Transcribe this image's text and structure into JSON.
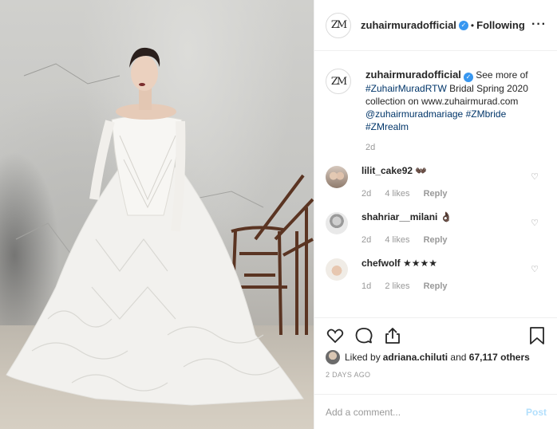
{
  "header": {
    "avatar_text": "ZM",
    "username": "zuhairmuradofficial",
    "separator": "•",
    "follow_status": "Following",
    "more_glyph": "···"
  },
  "caption": {
    "username": "zuhairmuradofficial",
    "text_1": " See more of ",
    "hashtag_1": "#ZuhairMuradRTW",
    "text_2": " Bridal Spring 2020 collection on www.zuhairmurad.com ",
    "mention": "@zuhairmuradmariage",
    "text_3": " ",
    "hashtag_2": "#ZMbride",
    "hashtag_3": "#ZMrealm",
    "time": "2d"
  },
  "comments": [
    {
      "username": "lilit_cake92",
      "text": " 👐🏿",
      "time": "2d",
      "likes": "4 likes",
      "reply": "Reply"
    },
    {
      "username": "shahriar__milani",
      "text": " 👌🏿",
      "time": "2d",
      "likes": "4 likes",
      "reply": "Reply"
    },
    {
      "username": "chefwolf",
      "text": " ★★★★",
      "time": "1d",
      "likes": "2 likes",
      "reply": "Reply"
    }
  ],
  "likes": {
    "prefix": "Liked by ",
    "user": "adriana.chiluti",
    "middle": " and ",
    "count": "67,117 others"
  },
  "post_date": "2 DAYS AGO",
  "add_comment": {
    "placeholder": "Add a comment...",
    "post_label": "Post"
  },
  "icons": {
    "header_avatar": "zm-logo-avatar",
    "verified": "verified-badge-icon",
    "heart": "heart-icon",
    "comment": "comment-icon",
    "share": "share-icon",
    "save": "bookmark-icon"
  },
  "colors": {
    "link": "#003569",
    "verified": "#3897f0",
    "muted": "#999999",
    "post_button": "#b2dffc"
  }
}
